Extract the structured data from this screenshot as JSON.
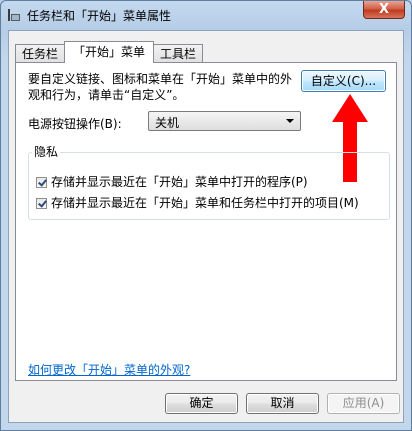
{
  "window": {
    "title": "任务栏和「开始」菜单属性",
    "close_label": "X"
  },
  "tabs": [
    {
      "label": "任务栏"
    },
    {
      "label": "「开始」菜单"
    },
    {
      "label": "工具栏"
    }
  ],
  "panel": {
    "description": "要自定义链接、图标和菜单在「开始」菜单中的外观和行为，请单击“自定义”。",
    "customize_label": "自定义(C)...",
    "power_label": "电源按钮操作(B):",
    "power_value": "关机",
    "privacy": {
      "legend": "隐私",
      "option1": "存储并显示最近在「开始」菜单中打开的程序(P)",
      "option2": "存储并显示最近在「开始」菜单和任务栏中打开的项目(M)"
    },
    "help_link": "如何更改「开始」菜单的外观?"
  },
  "buttons": {
    "ok": "确定",
    "cancel": "取消",
    "apply": "应用(A)"
  },
  "colors": {
    "arrow": "#ff0000",
    "link": "#0066cc"
  }
}
